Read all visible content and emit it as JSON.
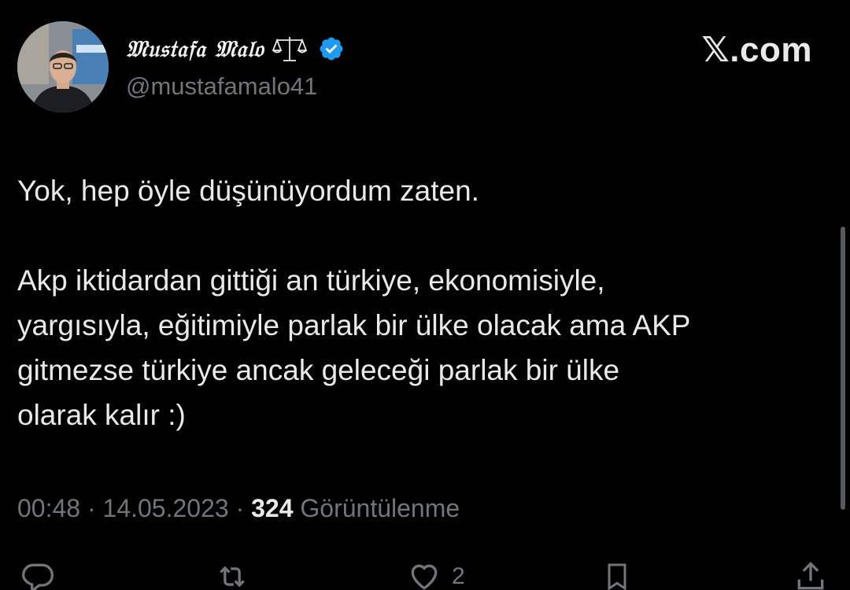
{
  "tweet": {
    "author": {
      "display_name": "𝔐𝔲𝔰𝔱𝔞𝔣𝔞 𝔐𝔞𝔩𝔬",
      "name_emoji_icon": "scales-icon",
      "verified_icon": "verified-badge-icon",
      "handle": "@mustafamalo41",
      "avatar_icon": "avatar-photo"
    },
    "brand": "𝕏.com",
    "text": {
      "paragraph_1": "Yok, hep öyle düşünüyordum zaten.",
      "paragraph_2_lines": [
        "Akp iktidardan gittiği an türkiye, ekonomisiyle,",
        "yargısıyla, eğitimiyle parlak bir ülke olacak ama AKP",
        "gitmezse türkiye ancak geleceği parlak bir ülke",
        "olarak kalır :)"
      ]
    },
    "meta": {
      "time": "00:48",
      "separator": " · ",
      "date": "14.05.2023",
      "views_count": "324",
      "views_label": "Görüntülenme"
    },
    "actions": {
      "reply_icon": "reply-icon",
      "retweet_icon": "retweet-icon",
      "like_icon": "heart-icon",
      "like_count": "2",
      "bookmark_icon": "bookmark-icon",
      "share_icon": "share-icon"
    }
  },
  "colors": {
    "background": "#000000",
    "primary_text": "#e7e9ea",
    "secondary_text": "#71767b",
    "verified_blue": "#1d9bf0"
  }
}
